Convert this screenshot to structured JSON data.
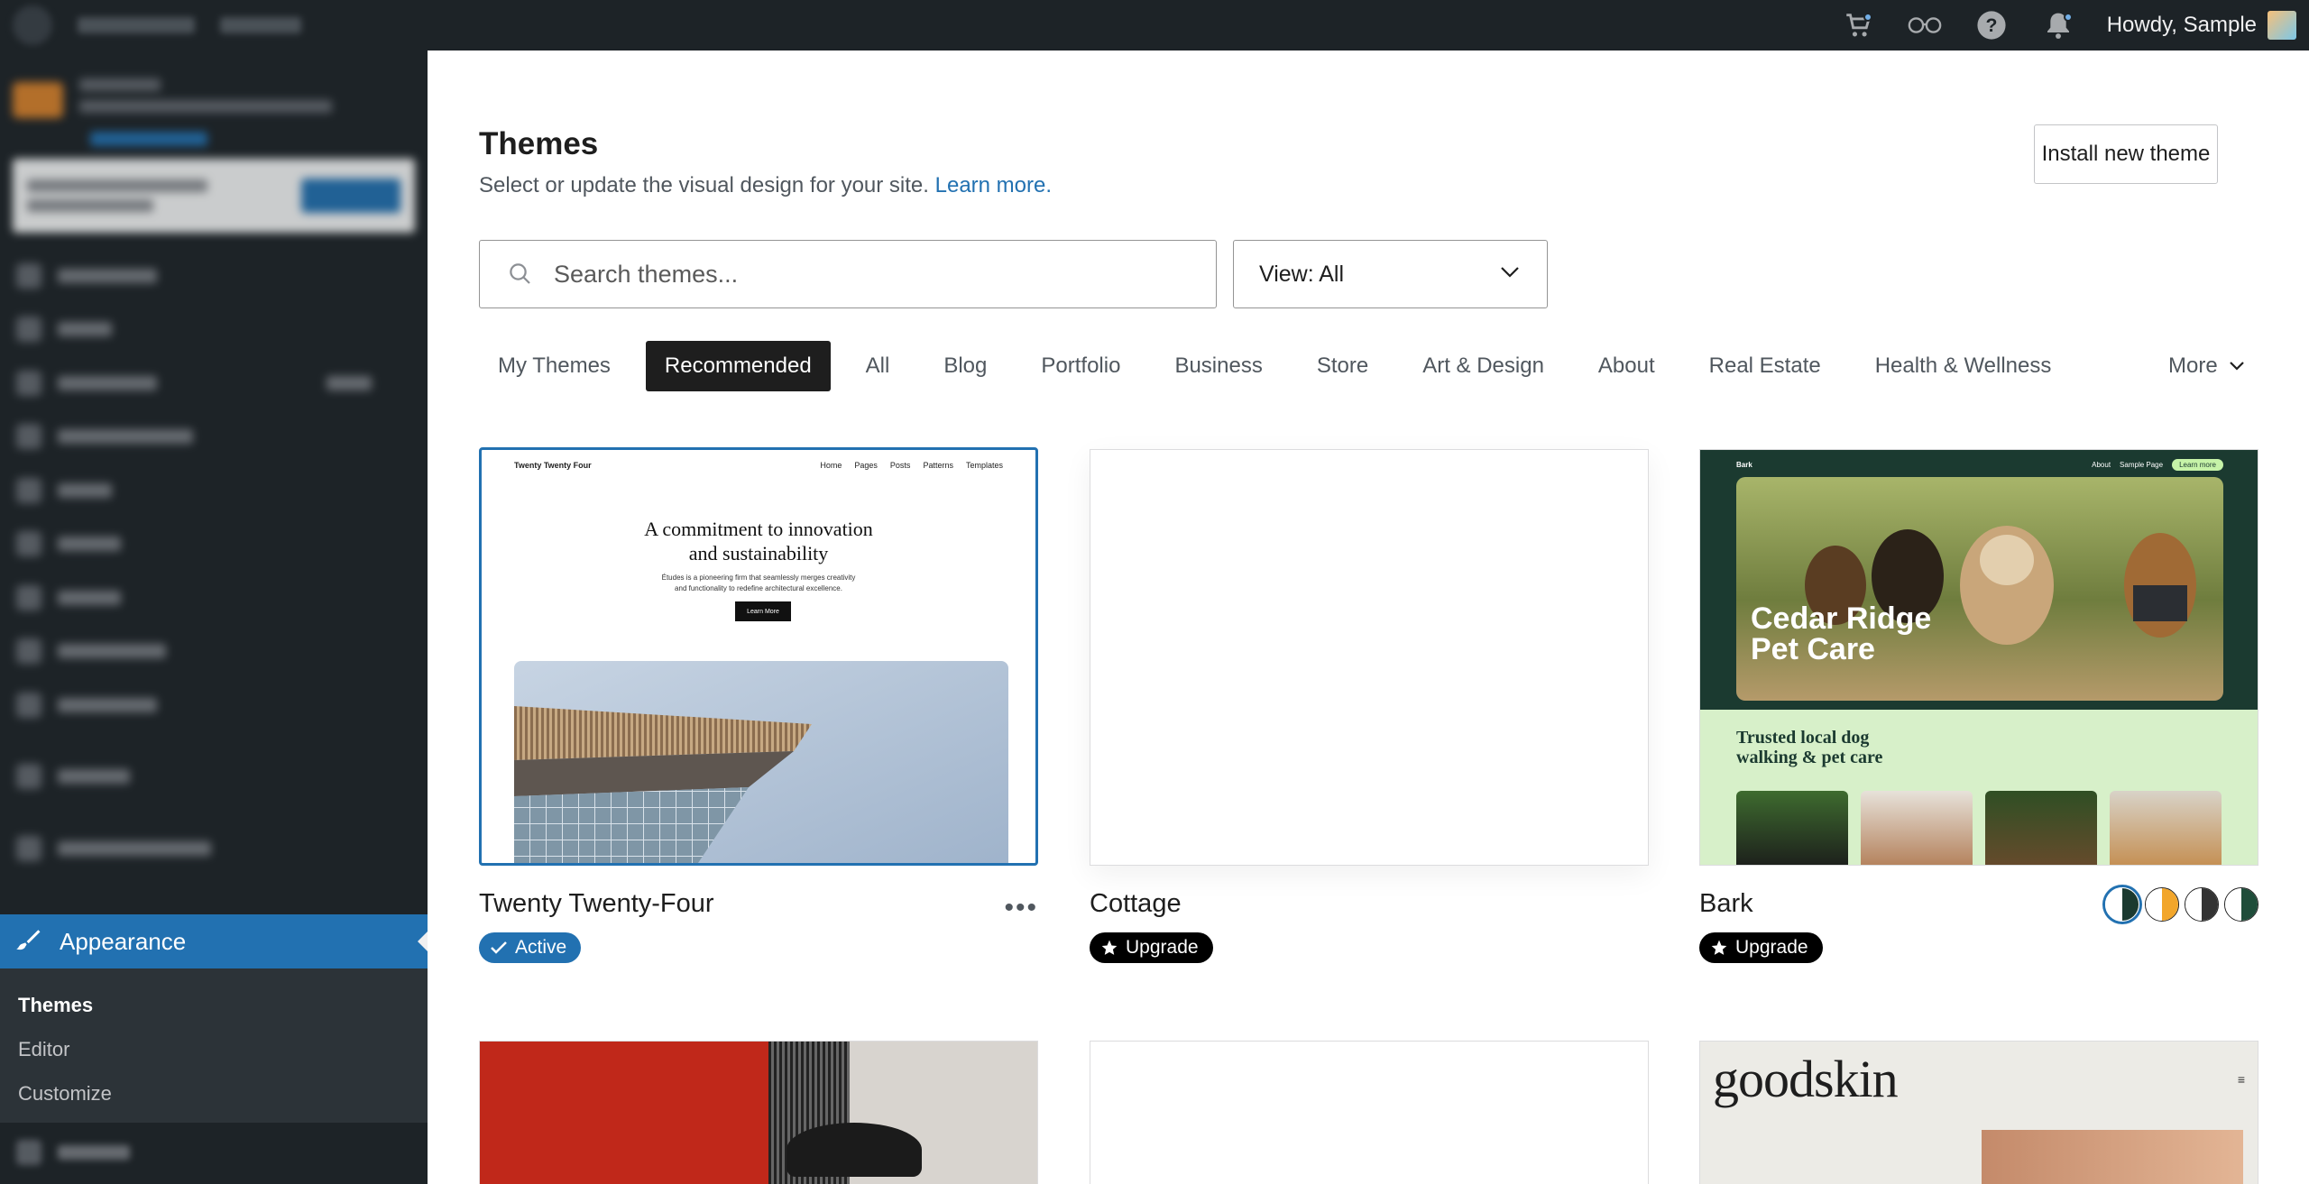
{
  "adminbar": {
    "howdy": "Howdy, Sample",
    "icons": [
      "cart-icon",
      "reader-icon",
      "help-icon",
      "notifications-icon"
    ]
  },
  "sidebar": {
    "appearance_label": "Appearance",
    "submenu": [
      "Themes",
      "Editor",
      "Customize"
    ]
  },
  "page": {
    "title": "Themes",
    "description": "Select or update the visual design for your site.",
    "learn_more": "Learn more.",
    "install_button": "Install new theme"
  },
  "search": {
    "placeholder": "Search themes..."
  },
  "view_select": {
    "value": "View: All"
  },
  "tabs": [
    "My Themes",
    "Recommended",
    "All",
    "Blog",
    "Portfolio",
    "Business",
    "Store",
    "Art & Design",
    "About",
    "Real Estate",
    "Health & Wellness"
  ],
  "tabs_active": "Recommended",
  "tabs_more": "More",
  "themes": [
    {
      "name": "Twenty Twenty-Four",
      "badge": "Active"
    },
    {
      "name": "Cottage",
      "badge": "Upgrade"
    },
    {
      "name": "Bark",
      "badge": "Upgrade"
    }
  ],
  "previews": {
    "tt4": {
      "site": "Twenty Twenty Four",
      "nav": [
        "Home",
        "Pages",
        "Posts",
        "Patterns",
        "Templates"
      ],
      "hero_line1": "A commitment to innovation",
      "hero_line2": "and sustainability",
      "sub_line1": "Études is a pioneering firm that seamlessly merges creativity",
      "sub_line2": "and functionality to redefine architectural excellence.",
      "button": "Learn More"
    },
    "bark": {
      "site": "Bark",
      "nav": [
        "About",
        "Sample Page"
      ],
      "nav_button": "Learn more",
      "hero_line1": "Cedar Ridge",
      "hero_line2": "Pet Care",
      "section_line1": "Trusted local dog",
      "section_line2": "walking & pet care"
    },
    "goodskin": {
      "title": "goodskin"
    }
  },
  "colors": {
    "accent": "#2271b1",
    "adminbar": "#1d2327"
  }
}
